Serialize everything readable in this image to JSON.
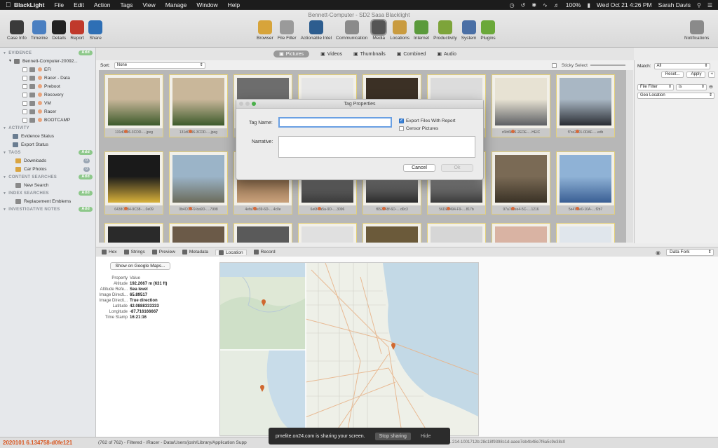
{
  "menubar": {
    "items": [
      "BlackLight",
      "File",
      "Edit",
      "Action",
      "Tags",
      "View",
      "Manage",
      "Window",
      "Help"
    ],
    "battery": "100%",
    "datetime": "Wed Oct 21  4:26 PM",
    "user": "Sarah Davis"
  },
  "window": {
    "title": "Bennett-Computer - SD2 Sasa Blacklight"
  },
  "toolbar": {
    "left": [
      {
        "label": "Case Info",
        "icon": "briefcase-icon",
        "color": "#3b3b3b"
      },
      {
        "label": "Timeline",
        "icon": "timeline-icon",
        "color": "#4a7fc1"
      },
      {
        "label": "Details",
        "icon": "details-icon",
        "color": "#222222"
      },
      {
        "label": "Report",
        "icon": "report-icon",
        "color": "#c0392b"
      },
      {
        "label": "Share",
        "icon": "share-icon",
        "color": "#2e6fb5"
      }
    ],
    "center": [
      {
        "label": "Browser",
        "icon": "browser-icon",
        "color": "#d7a43a"
      },
      {
        "label": "File Filter",
        "icon": "filter-icon",
        "color": "#9a9a9a"
      },
      {
        "label": "Actionable Intel",
        "icon": "intel-icon",
        "color": "#2d5d8f"
      },
      {
        "label": "Communication",
        "icon": "communication-icon",
        "color": "#8a8a8a"
      },
      {
        "label": "Media",
        "icon": "media-icon",
        "color": "#555555"
      },
      {
        "label": "Locations",
        "icon": "locations-icon",
        "color": "#c99b3f"
      },
      {
        "label": "Internet",
        "icon": "internet-icon",
        "color": "#5a9a3b"
      },
      {
        "label": "Productivity",
        "icon": "productivity-icon",
        "color": "#7da43a"
      },
      {
        "label": "System",
        "icon": "system-icon",
        "color": "#4a6fa5"
      },
      {
        "label": "Plugins",
        "icon": "plugins-icon",
        "color": "#6aa83a"
      }
    ],
    "right": {
      "label": "Notifications",
      "icon": "notifications-icon",
      "color": "#8a8a8a"
    }
  },
  "sidebar": {
    "evidence_header": "EVIDENCE",
    "evidence_root": "Bennett-Computer-20092...",
    "evidence_items": [
      {
        "label": "EFI",
        "color": "#e9a37a"
      },
      {
        "label": "Racer - Data",
        "color": "#e9a37a"
      },
      {
        "label": "Preboot",
        "color": "#e9a37a"
      },
      {
        "label": "Recovery",
        "color": "#e9a37a"
      },
      {
        "label": "VM",
        "color": "#e9a37a"
      },
      {
        "label": "Racer",
        "color": "#e9a37a"
      },
      {
        "label": "BOOTCAMP",
        "color": "#e9a37a"
      }
    ],
    "activity_header": "ACTIVITY",
    "activity_items": [
      "Evidence Status",
      "Export Status"
    ],
    "tags_header": "TAGS",
    "tags_items": [
      {
        "label": "Downloads",
        "count": "0"
      },
      {
        "label": "Car Photos",
        "count": "0"
      }
    ],
    "content_header": "CONTENT SEARCHES",
    "content_items": [
      "New Search"
    ],
    "index_header": "INDEX SEARCHES",
    "index_items": [
      "Replacement Emblems"
    ],
    "notes_header": "INVESTIGATIVE NOTES",
    "add_label": "Add"
  },
  "views": {
    "tabs": [
      "Pictures",
      "Videos",
      "Thumbnails",
      "Combined",
      "Audio"
    ],
    "active": "Pictures",
    "sort_label": "Sort:",
    "sort_value": "None",
    "sticky_select": "Sticky Select"
  },
  "thumbnails": [
    {
      "caption": "131d0496-3CDD-....jpeg",
      "colors": [
        "#c9b79a",
        "#3d5a2b"
      ]
    },
    {
      "caption": "131d0496-3CDD-....jpeg",
      "colors": [
        "#c9b79a",
        "#3d5a2b"
      ]
    },
    {
      "caption": "",
      "colors": [
        "#6d6d6d",
        "#8a8a8a"
      ]
    },
    {
      "caption": "",
      "colors": [
        "#e6e6e6",
        "#333333"
      ]
    },
    {
      "caption": "",
      "colors": [
        "#3b3025",
        "#b98b6f"
      ]
    },
    {
      "caption": "",
      "colors": [
        "#dcdcdc",
        "#555555"
      ]
    },
    {
      "caption": "c6fd6bb6-2EDE-....HEIC",
      "colors": [
        "#e7e2d3",
        "#5d5f63"
      ]
    },
    {
      "caption": "f7ce2801-0DAF-....edb",
      "colors": [
        "#a9b7c4",
        "#2a2d33"
      ]
    },
    {
      "caption": "6438C4B4-9C38-....0e09",
      "colors": [
        "#1a1a1a",
        "#d8b13a"
      ]
    },
    {
      "caption": "0b4C07F9-ba9D-....7998",
      "colors": [
        "#9bb4c8",
        "#6b6b5b"
      ]
    },
    {
      "caption": "4efa7f9e39-6D-....4c0e",
      "colors": [
        "#8a6a4a",
        "#c8a07a"
      ]
    },
    {
      "caption": "6e6f4fa5a-9D-....3096",
      "colors": [
        "#7a7a7a",
        "#3a3a3a"
      ]
    },
    {
      "caption": "f652248f-6D-....d0c3",
      "colors": [
        "#8a8a8a",
        "#2a2a2a"
      ]
    },
    {
      "caption": "56DE0494-F9-....817b",
      "colors": [
        "#9a9a9a",
        "#3a3a3a"
      ]
    },
    {
      "caption": "97a7c5ee4-5C-....1216",
      "colors": [
        "#7a6a55",
        "#3a3226"
      ]
    },
    {
      "caption": "5e47f9e0-10A-....f2b7",
      "colors": [
        "#8fb2d6",
        "#3a5f94"
      ]
    },
    {
      "caption": "",
      "colors": [
        "#2a2a2a",
        "#555555"
      ]
    },
    {
      "caption": "",
      "colors": [
        "#6b5a48",
        "#c9c1b3"
      ]
    },
    {
      "caption": "",
      "colors": [
        "#5a5a5a",
        "#e6e6e6"
      ]
    },
    {
      "caption": "",
      "colors": [
        "#e0e0e0",
        "#777777"
      ]
    },
    {
      "caption": "",
      "colors": [
        "#6b5a3a",
        "#b89a6a"
      ]
    },
    {
      "caption": "",
      "colors": [
        "#d6d6d6",
        "#8a8a8a"
      ]
    },
    {
      "caption": "",
      "colors": [
        "#d9b3a3",
        "#8a6b5a"
      ]
    },
    {
      "caption": "",
      "colors": [
        "#e0e6ec",
        "#6a7a8a"
      ]
    }
  ],
  "dialog": {
    "title": "Tag Properties",
    "tag_name_label": "Tag Name:",
    "tag_name_value": "",
    "narrative_label": "Narrative:",
    "narrative_value": "",
    "export_label": "Export Files With Report",
    "export_checked": true,
    "censor_label": "Censor Pictures",
    "censor_checked": false,
    "cancel": "Cancel",
    "ok": "Ok"
  },
  "right_panel": {
    "match_label": "Match:",
    "match_value": "All",
    "reset": "Reset...",
    "apply": "Apply",
    "filter_label": "File Filter",
    "filter_op": "is",
    "geo_label": "Geo Location"
  },
  "bottom_tabs": {
    "tabs": [
      "Hex",
      "Strings",
      "Preview",
      "Metadata",
      "Location",
      "Record"
    ],
    "active": "Location",
    "data_fork": "Data Fork"
  },
  "location": {
    "google_maps": "Show on Google Maps...",
    "header_property": "Property",
    "header_value": "Value",
    "rows": [
      {
        "k": "Altitude",
        "v": "192.2667 m (631 ft)"
      },
      {
        "k": "Altitude Refe...",
        "v": "Sea level"
      },
      {
        "k": "Image Directi...",
        "v": "65.89517"
      },
      {
        "k": "Image Directi...",
        "v": "True direction"
      },
      {
        "k": "Latitude",
        "v": "42.0888333333"
      },
      {
        "k": "Longitude",
        "v": "-87.716166667"
      },
      {
        "k": "Time Stamp",
        "v": "16:21:16"
      }
    ]
  },
  "status": {
    "hash": "2020101 6.134758-d0fe121",
    "summary": "(762 of 762) - Filtered  -  /Racer - Data/Users/josh/Library/Application Supp",
    "right": "...214-1001712b:28c18f9398c1d-aaee7eb4b48e7f6a5c9e38c0"
  },
  "share_banner": {
    "text": "pmelite.on24.com is sharing your screen.",
    "stop": "Stop sharing",
    "hide": "Hide"
  }
}
